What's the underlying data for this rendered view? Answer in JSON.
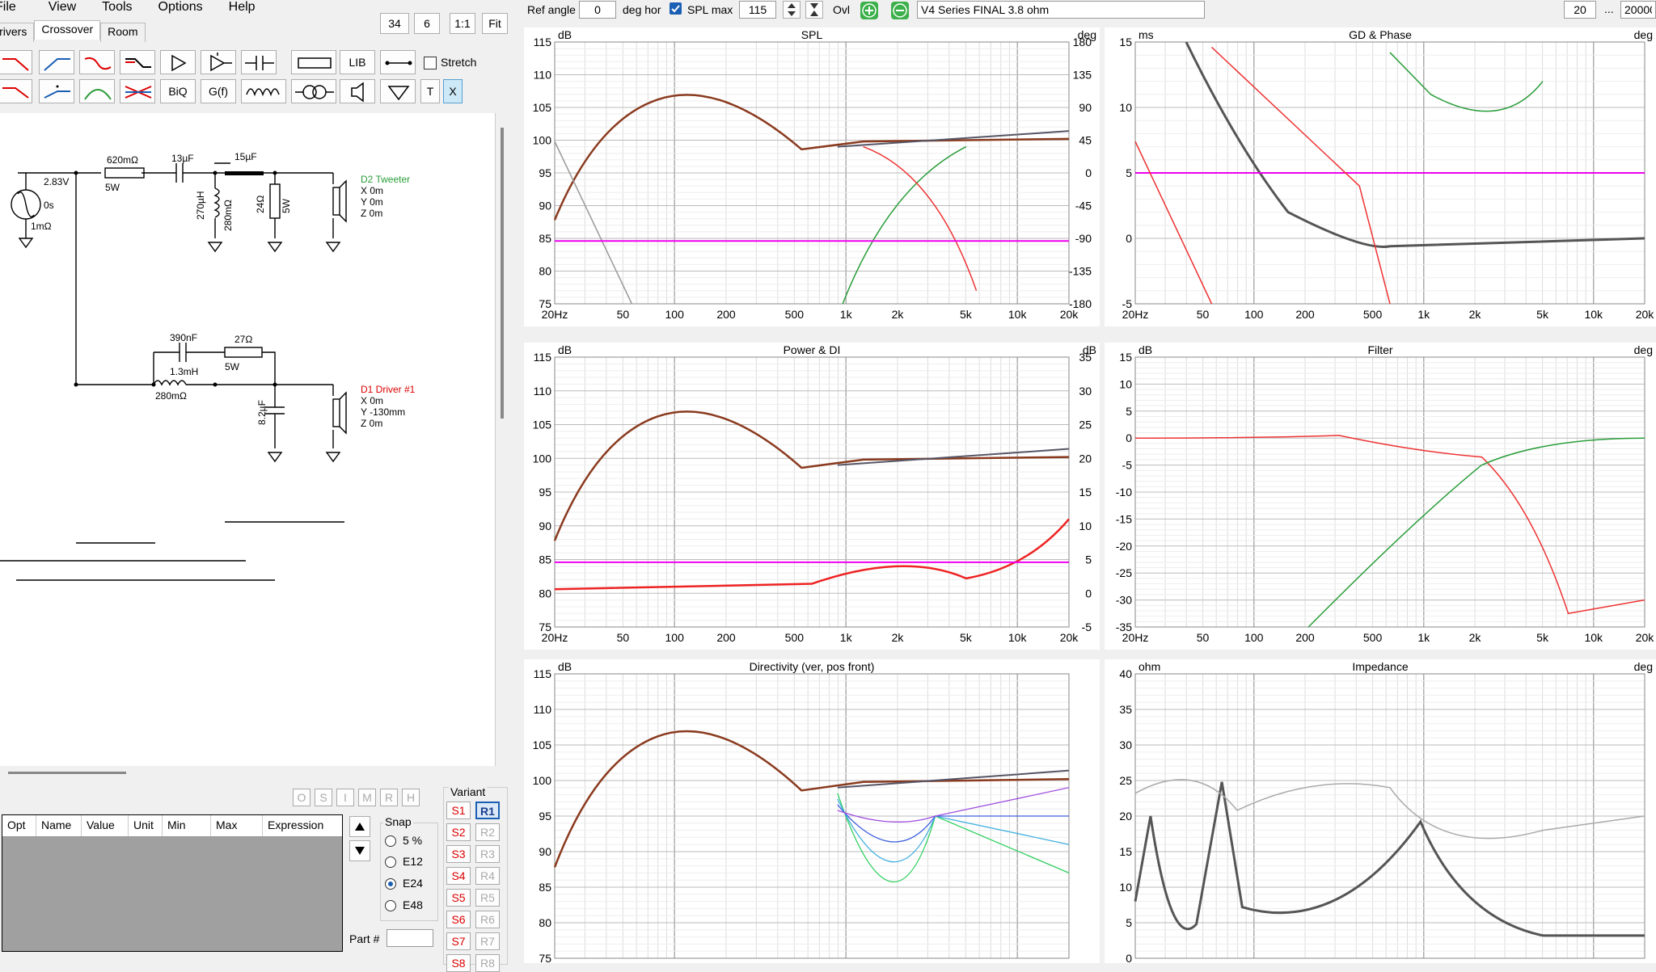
{
  "menu": [
    "File",
    "View",
    "Tools",
    "Options",
    "Help"
  ],
  "tabs": [
    "Drivers",
    "Crossover",
    "Room"
  ],
  "zoom": {
    "a": "34",
    "b": "6",
    "c": "1:1",
    "d": "Fit"
  },
  "toolbar": {
    "lib": "LIB",
    "stretch": "Stretch",
    "biq": "BiQ",
    "gf": "G(f)",
    "t": "T",
    "x": "X"
  },
  "top": {
    "ref_angle_label": "Ref angle",
    "ref_angle": "0",
    "deg_hor": "deg hor",
    "spl_max_label": "SPL max",
    "spl_max": "115",
    "ovl": "Ovl",
    "project": "V4 Series FINAL 3.8 ohm",
    "f_min": "20",
    "dots": "...",
    "f_max": "20000"
  },
  "schematic": {
    "source_v": "2.83V",
    "source_t": "0s",
    "source_r": "1mΩ",
    "r1": "620mΩ",
    "r1w": "5W",
    "c1": "13µF",
    "c2": "15µF",
    "l1": "270µH",
    "l1r": "280mΩ",
    "r2": "24Ω",
    "r2w": "5W",
    "tweeter": "D2 Tweeter",
    "tw_x": "X 0m",
    "tw_y": "Y 0m",
    "tw_z": "Z 0m",
    "c3": "390nF",
    "r3": "27Ω",
    "r3w": "5W",
    "l2": "1.3mH",
    "l2r": "280mΩ",
    "c4": "8.2µF",
    "driver": "D1 Driver #1",
    "dr_x": "X 0m",
    "dr_y": "Y -130mm",
    "dr_z": "Z 0m"
  },
  "table": {
    "headers": [
      "Opt",
      "Name",
      "Value",
      "Unit",
      "Min",
      "Max",
      "Expression"
    ]
  },
  "status_buttons": [
    "O",
    "S",
    "I",
    "M",
    "R",
    "H"
  ],
  "snap": {
    "title": "Snap",
    "options": [
      "5 %",
      "E12",
      "E24",
      "E48"
    ],
    "selected": 2
  },
  "variant": {
    "title": "Variant",
    "s": [
      "S1",
      "S2",
      "S3",
      "S4",
      "S5",
      "S6",
      "S7",
      "S8"
    ],
    "r": [
      "R1",
      "R2",
      "R3",
      "R4",
      "R5",
      "R6",
      "R7",
      "R8"
    ],
    "part_label": "Part #"
  },
  "charts": {
    "spl": {
      "title": "SPL",
      "ylabel": "dB",
      "y2label": "deg",
      "yticks": [
        "115",
        "110",
        "105",
        "100",
        "95",
        "90",
        "85",
        "80",
        "75"
      ],
      "y2ticks": [
        "180",
        "135",
        "90",
        "45",
        "0",
        "-45",
        "-90",
        "-135",
        "-180"
      ]
    },
    "gd": {
      "title": "GD & Phase",
      "ylabel": "ms",
      "y2label": "deg",
      "yticks": [
        "15",
        "10",
        "5",
        "0",
        "-5"
      ]
    },
    "power": {
      "title": "Power & DI",
      "ylabel": "dB",
      "y2label": "dB",
      "yticks": [
        "115",
        "110",
        "105",
        "100",
        "95",
        "90",
        "85",
        "80",
        "75"
      ],
      "y2ticks": [
        "35",
        "30",
        "25",
        "20",
        "15",
        "10",
        "5",
        "0",
        "-5"
      ]
    },
    "filter": {
      "title": "Filter",
      "ylabel": "dB",
      "y2label": "deg",
      "yticks": [
        "15",
        "10",
        "5",
        "0",
        "-5",
        "-10",
        "-15",
        "-20",
        "-25",
        "-30",
        "-35"
      ]
    },
    "dir": {
      "title": "Directivity (ver, pos front)",
      "ylabel": "dB",
      "yticks": [
        "115",
        "110",
        "105",
        "100",
        "95",
        "90",
        "85",
        "80",
        "75"
      ]
    },
    "imp": {
      "title": "Impedance",
      "ylabel": "ohm",
      "y2label": "deg",
      "yticks": [
        "40",
        "35",
        "30",
        "25",
        "20",
        "15",
        "10",
        "5",
        "0"
      ]
    },
    "xticks": [
      "20Hz",
      "50",
      "100",
      "200",
      "500",
      "1k",
      "2k",
      "5k",
      "10k",
      "20k"
    ]
  }
}
